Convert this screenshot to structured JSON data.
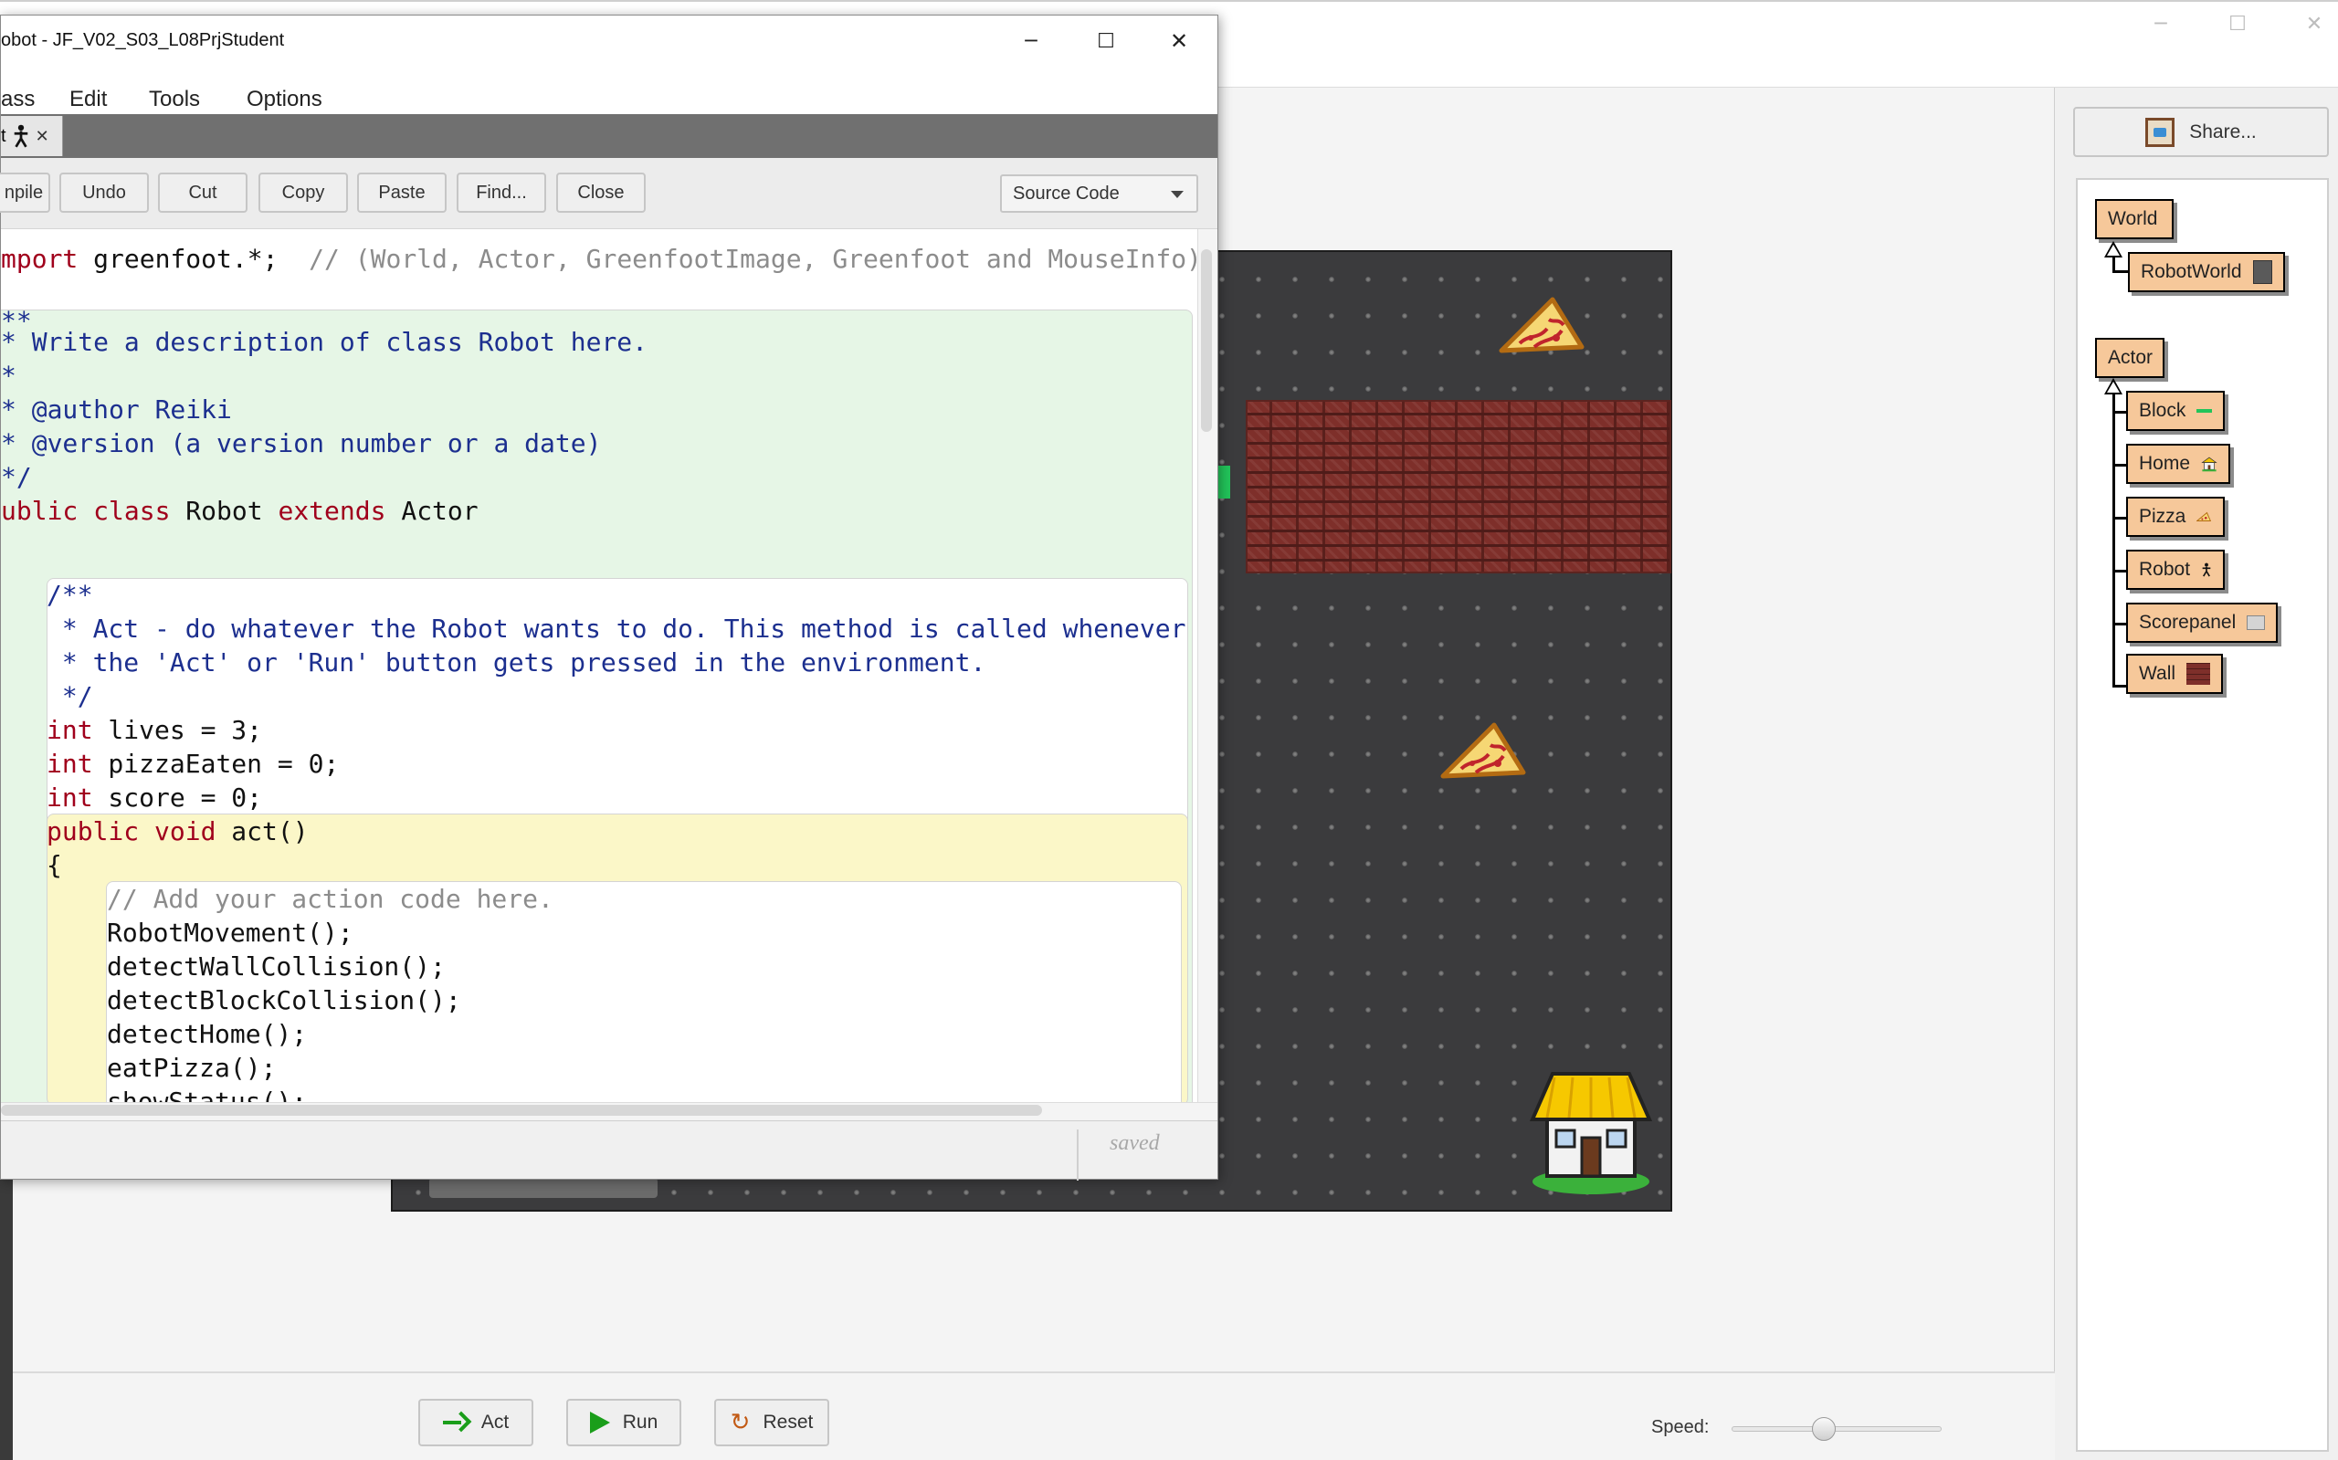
{
  "editor": {
    "title": "obot - JF_V02_S03_L08PrjStudent",
    "menu": [
      "ass",
      "Edit",
      "Tools",
      "Options"
    ],
    "tab_label": "t",
    "toolbar": {
      "compile": "npile",
      "undo": "Undo",
      "cut": "Cut",
      "copy": "Copy",
      "paste": "Paste",
      "find": "Find...",
      "close": "Close",
      "view_mode": "Source Code"
    },
    "code": {
      "l1_kw": "mport",
      "l1_rest": " greenfoot.*;  ",
      "l1_comment": "// (World, Actor, GreenfootImage, Greenfoot and MouseInfo)",
      "l2": "**",
      "l3": "* Write a description of class Robot here.",
      "l4": "*",
      "l5": "* @author Reiki",
      "l6": "* @version (a version number or a date)",
      "l7": "*/",
      "l8_a": "ublic ",
      "l8_kw1": "class",
      "l8_b": " Robot ",
      "l8_kw2": "extends",
      "l8_c": " Actor",
      "l9": "/**",
      "l10": " * Act - do whatever the Robot wants to do. This method is called whenever",
      "l11": " * the 'Act' or 'Run' button gets pressed in the environment.",
      "l12": " */",
      "l13_kw": "int",
      "l13_rest": " lives = 3;",
      "l14_kw": "int",
      "l14_rest": " pizzaEaten = 0;",
      "l15_kw": "int",
      "l15_rest": " score = 0;",
      "l16_kw": "public void",
      "l16_rest": " act()",
      "l17": "{",
      "l18": "// Add your action code here.",
      "l19": "RobotMovement();",
      "l20": "detectWallCollision();",
      "l21": "detectBlockCollision();",
      "l22": "detectHome();",
      "l23": "eatPizza();",
      "l24": "showStatus();"
    },
    "status": "saved"
  },
  "controls": {
    "act": "Act",
    "run": "Run",
    "reset": "Reset",
    "speed_label": "Speed:",
    "speed_value": 0.44
  },
  "share": "Share...",
  "classes": {
    "world": "World",
    "robot_world": "RobotWorld",
    "actor": "Actor",
    "subclasses": [
      "Block",
      "Home",
      "Pizza",
      "Robot",
      "Scorepanel",
      "Wall"
    ]
  },
  "icons": {
    "minimize": "minimize-icon",
    "maximize": "maximize-icon",
    "close": "close-icon",
    "robot": "robot-figure-icon",
    "pizza": "pizza-slice-icon",
    "home": "house-icon",
    "share": "easel-icon"
  },
  "colors": {
    "class_box": "#f6c89a",
    "keyword": "#a0001c",
    "doc_comment": "#1c2f8f",
    "class_scope": "#e6f6e6",
    "method_scope": "#fbf7c8",
    "world_bg": "#3b3b3d",
    "block_green": "#22c45a"
  }
}
